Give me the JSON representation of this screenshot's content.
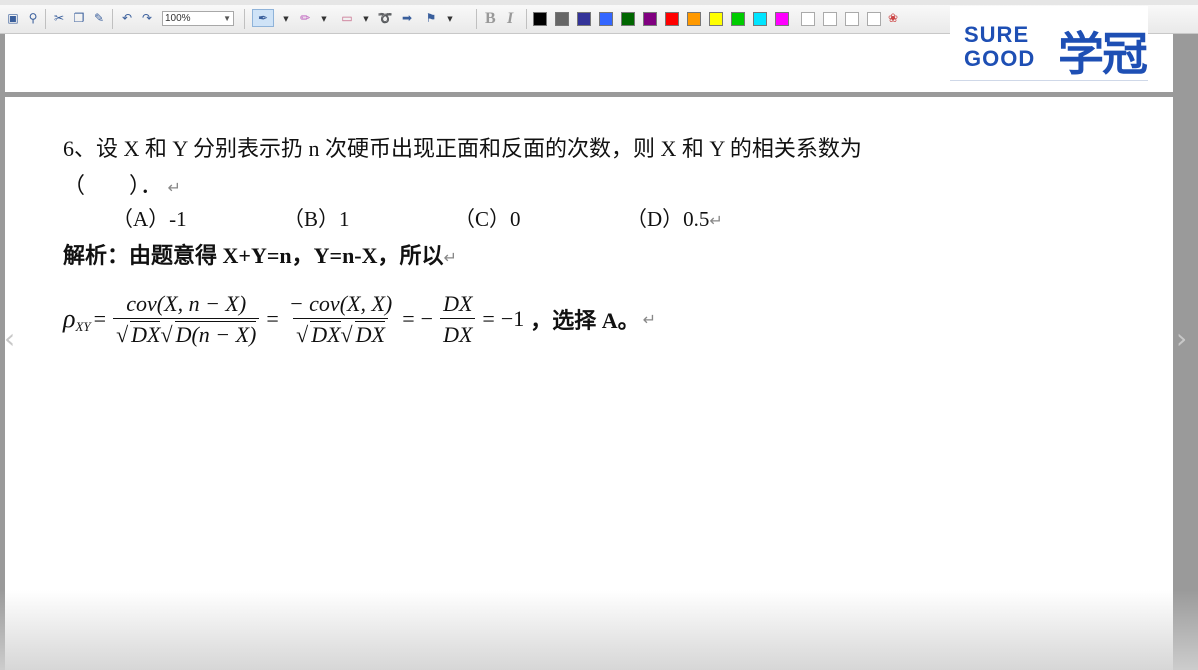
{
  "toolbar": {
    "zoom_value": "100%",
    "bold_label": "B",
    "italic_label": "I",
    "icons": [
      "save-icon",
      "find-icon",
      "cut-icon",
      "copy-icon",
      "paste-icon",
      "undo-icon",
      "redo-icon",
      "pen-icon",
      "highlighter-icon",
      "eraser-icon",
      "lasso-icon",
      "insert-icon",
      "flag-icon",
      "palette-icon"
    ],
    "colors": [
      "#000000",
      "#666666",
      "#333399",
      "#3366ff",
      "#006600",
      "#800080",
      "#ff0000",
      "#ff9900",
      "#ffff00",
      "#00cc00",
      "#00e5ff",
      "#ff00ff",
      "#ffffff",
      "#ffffff",
      "#ffffff",
      "#ffffff"
    ]
  },
  "logo": {
    "line1": "SURE",
    "line2": "GOOD",
    "cn": "学冠"
  },
  "question": {
    "line1": "6、设 X 和 Y 分别表示扔 n 次硬币出现正面和反面的次数，则 X 和 Y 的相关系数为",
    "line2": "（　　）．",
    "options": [
      "（A）-1",
      "（B）1",
      "（C）0",
      "（D）0.5"
    ]
  },
  "solution": {
    "label": "解析：",
    "text1": "由题意得 ",
    "eq1": "X+Y=n",
    "comma": "，",
    "eq2": "Y=n-X",
    "text2": "，所以",
    "conclusion_pre": "，选择 ",
    "answer": "A",
    "conclusion_post": "。"
  },
  "formula": {
    "rho": "ρ",
    "sub": "XY",
    "num1": "cov(X, n − X)",
    "den1a": "DX",
    "den1b": "D(n − X)",
    "num2": "− cov(X, X)",
    "den2a": "DX",
    "den2b": "DX",
    "neg": "−",
    "num3": "DX",
    "den3": "DX",
    "result": "−1"
  },
  "marks": {
    "return": "↵"
  },
  "nav": {
    "prev": "‹",
    "next": "›"
  }
}
